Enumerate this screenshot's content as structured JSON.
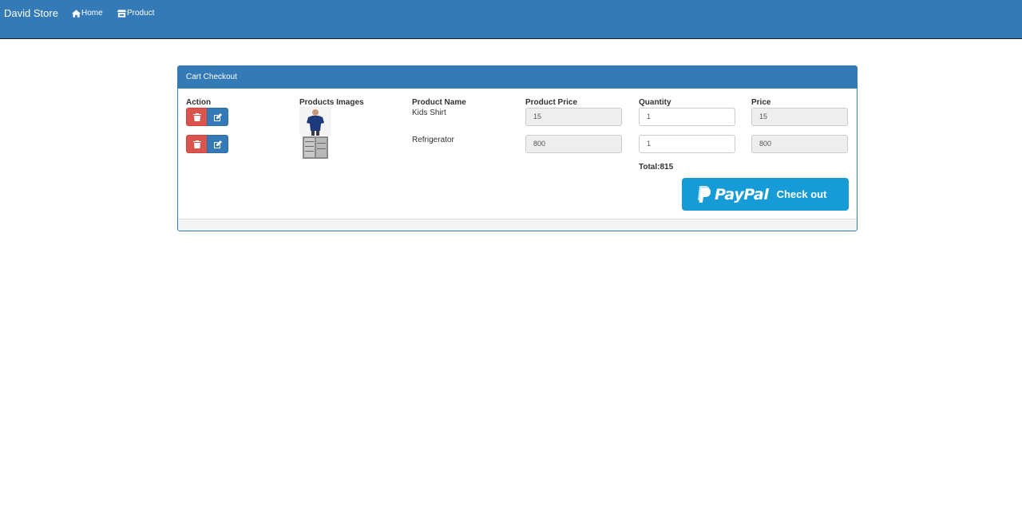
{
  "navbar": {
    "brand": "David Store",
    "links": [
      {
        "label": "Home",
        "icon": "home-icon"
      },
      {
        "label": "Product",
        "icon": "store-icon"
      }
    ],
    "bg_color": "#337ab7"
  },
  "panel": {
    "title": "Cart Checkout",
    "columns": [
      "Action",
      "Products Images",
      "Product Name",
      "Product Price",
      "Quantity",
      "Price"
    ],
    "rows": [
      {
        "name": "Kids Shirt",
        "product_price": "15",
        "quantity": "1",
        "price": "15",
        "image": "kids-shirt-image"
      },
      {
        "name": "Refrigerator",
        "product_price": "800",
        "quantity": "1",
        "price": "800",
        "image": "refrigerator-image"
      }
    ],
    "total": "Total:815",
    "checkout": {
      "brand": "PayPal",
      "label": "Check out",
      "color": "#179bd7"
    }
  },
  "colors": {
    "danger": "#d9534f",
    "primary": "#337ab7"
  }
}
